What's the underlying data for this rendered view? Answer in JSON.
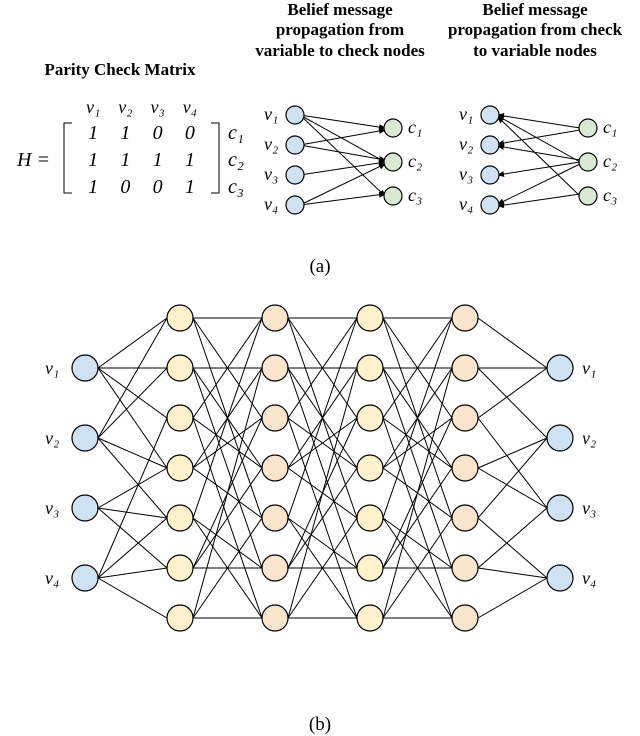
{
  "part_a": {
    "matrix_title": "Parity Check Matrix",
    "title_v2c": "Belief message propagation from variable to check nodes",
    "title_c2v": "Belief message propagation from check to variable nodes",
    "H_symbol": "H =",
    "col_headers": [
      "v₁",
      "v₂",
      "v₃",
      "v₄"
    ],
    "row_headers": [
      "c₁",
      "c₂",
      "c₃"
    ],
    "matrix": [
      [
        1,
        1,
        0,
        0
      ],
      [
        1,
        1,
        1,
        1
      ],
      [
        1,
        0,
        0,
        1
      ]
    ],
    "v_labels": [
      "v₁",
      "v₂",
      "v₃",
      "v₄"
    ],
    "c_labels": [
      "c₁",
      "c₂",
      "c₃"
    ]
  },
  "part_b": {
    "left_labels": [
      "v₁",
      "v₂",
      "v₃",
      "v₄"
    ],
    "right_labels": [
      "v₁",
      "v₂",
      "v₃",
      "v₄"
    ]
  },
  "chart_data": {
    "type": "diagram",
    "parity_check_matrix": {
      "variables": [
        "v1",
        "v2",
        "v3",
        "v4"
      ],
      "checks": [
        "c1",
        "c2",
        "c3"
      ],
      "H": [
        [
          1,
          1,
          0,
          0
        ],
        [
          1,
          1,
          1,
          1
        ],
        [
          1,
          0,
          0,
          1
        ]
      ],
      "edges": [
        [
          "v1",
          "c1"
        ],
        [
          "v2",
          "c1"
        ],
        [
          "v1",
          "c2"
        ],
        [
          "v2",
          "c2"
        ],
        [
          "v3",
          "c2"
        ],
        [
          "v4",
          "c2"
        ],
        [
          "v1",
          "c3"
        ],
        [
          "v4",
          "c3"
        ]
      ]
    },
    "unrolled_network": {
      "layers": [
        {
          "name": "input",
          "count": 4,
          "color": "blue"
        },
        {
          "name": "v2c-1",
          "count": 7,
          "color": "yellow"
        },
        {
          "name": "c2v-1",
          "count": 7,
          "color": "orange"
        },
        {
          "name": "v2c-2",
          "count": 7,
          "color": "yellow"
        },
        {
          "name": "c2v-2",
          "count": 7,
          "color": "orange"
        },
        {
          "name": "output",
          "count": 4,
          "color": "blue"
        }
      ]
    }
  },
  "captions": {
    "a": "(a)",
    "b": "(b)"
  }
}
